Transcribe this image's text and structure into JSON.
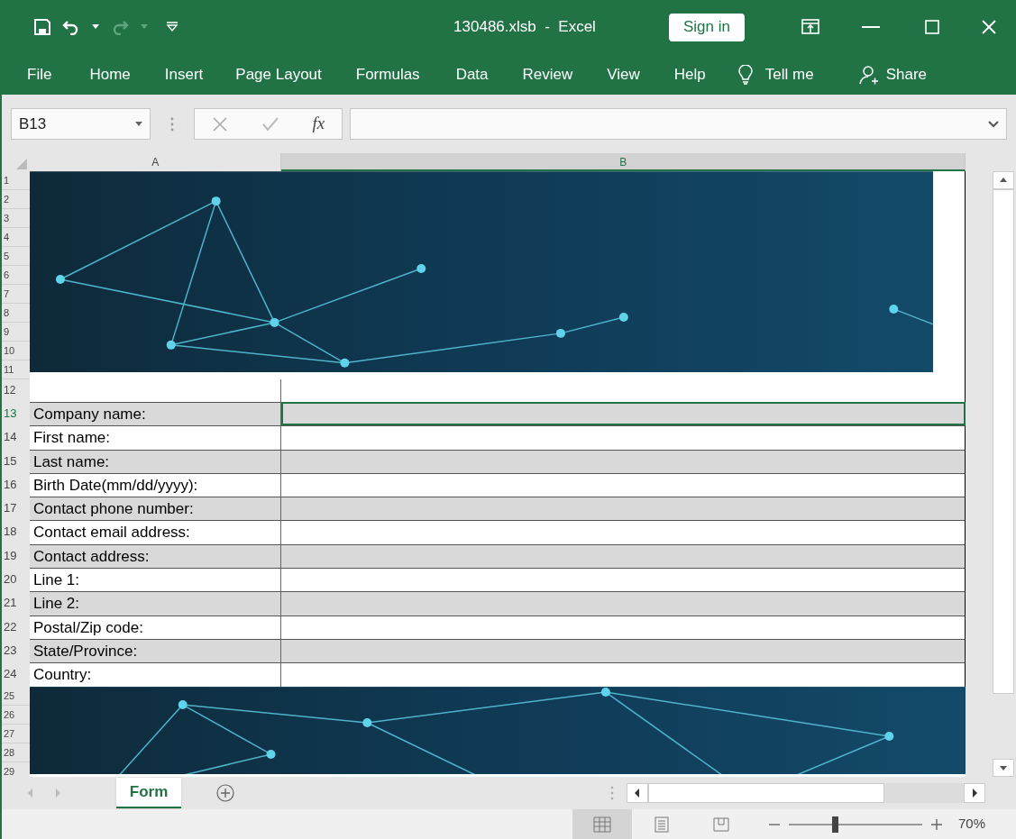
{
  "window": {
    "title": "130486.xlsb  -  Excel",
    "sign_in": "Sign in"
  },
  "ribbon_tabs": [
    "File",
    "Home",
    "Insert",
    "Page Layout",
    "Formulas",
    "Data",
    "Review",
    "View",
    "Help"
  ],
  "tell_me": "Tell me",
  "share": "Share",
  "formula_bar": {
    "name_box": "B13",
    "function_label": "fx"
  },
  "columns": [
    {
      "label": "A",
      "selected": false
    },
    {
      "label": "B",
      "selected": true
    }
  ],
  "banner_top_rows": [
    "1",
    "2",
    "3",
    "4",
    "5",
    "6",
    "7",
    "8",
    "9",
    "10",
    "11"
  ],
  "blank_row": "12",
  "form_rows": [
    {
      "row": "13",
      "label": "Company name:",
      "shaded": true,
      "selected": true
    },
    {
      "row": "14",
      "label": "First name:",
      "shaded": false,
      "selected": false
    },
    {
      "row": "15",
      "label": "Last name:",
      "shaded": true,
      "selected": false
    },
    {
      "row": "16",
      "label": "Birth Date(mm/dd/yyyy):",
      "shaded": false,
      "selected": false
    },
    {
      "row": "17",
      "label": "Contact phone number:",
      "shaded": true,
      "selected": false
    },
    {
      "row": "18",
      "label": "Contact email address:",
      "shaded": false,
      "selected": false
    },
    {
      "row": "19",
      "label": "Contact address:",
      "shaded": true,
      "selected": false
    },
    {
      "row": "20",
      "label": "Line 1:",
      "shaded": false,
      "selected": false
    },
    {
      "row": "21",
      "label": "Line 2:",
      "shaded": true,
      "selected": false
    },
    {
      "row": "22",
      "label": "Postal/Zip code:",
      "shaded": false,
      "selected": false
    },
    {
      "row": "23",
      "label": "State/Province:",
      "shaded": true,
      "selected": false
    },
    {
      "row": "24",
      "label": "Country:",
      "shaded": false,
      "selected": false
    }
  ],
  "banner_bottom_rows": [
    "25",
    "26",
    "27",
    "28",
    "29"
  ],
  "sheet_tabs": [
    {
      "label": "Form",
      "selected": true
    }
  ],
  "status_bar": {
    "views": [
      {
        "kind": "normal",
        "selected": true
      },
      {
        "kind": "page_layout",
        "selected": false
      },
      {
        "kind": "page_break",
        "selected": false
      }
    ],
    "zoom_slider": {
      "level": 0.36
    },
    "zoom": "70%"
  }
}
